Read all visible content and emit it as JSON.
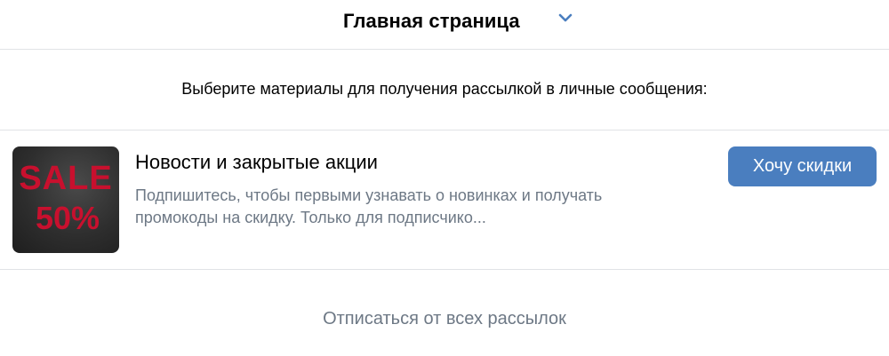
{
  "header": {
    "title": "Главная страница",
    "dropdown_icon": "chevron-down-icon",
    "accent_color": "#4a7ebf"
  },
  "intro": {
    "text": "Выберите материалы для получения рассылкой в личные сообщения:"
  },
  "subscription": {
    "image": {
      "text_top": "SALE",
      "text_bottom": "50%",
      "text_color": "#c8102e",
      "background_color": "#2e2e2e"
    },
    "title": "Новости и закрытые акции",
    "description": "Подпишитесь, чтобы первыми узнавать о новинках и получать промокоды на скидку. Только для подписчико...",
    "button_label": "Хочу скидки",
    "button_color": "#4a7ebf"
  },
  "footer": {
    "unsubscribe_label": "Отписаться от всех рассылок"
  }
}
